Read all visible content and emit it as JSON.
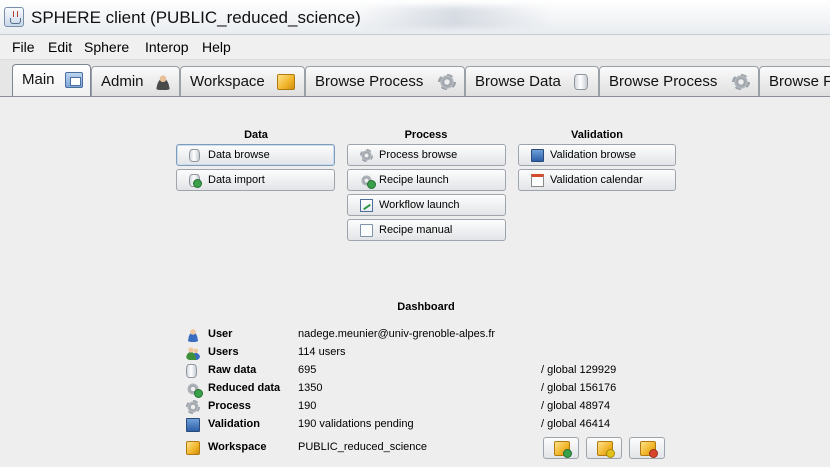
{
  "window": {
    "title": "SPHERE client (PUBLIC_reduced_science)"
  },
  "menu": [
    "File",
    "Edit",
    "Sphere",
    "Interop",
    "Help"
  ],
  "tabs": [
    {
      "label": "Main",
      "icon": "window-icon",
      "active": true
    },
    {
      "label": "Admin",
      "icon": "admin-user-icon"
    },
    {
      "label": "Workspace",
      "icon": "workspace-box-icon"
    },
    {
      "label": "Browse Process",
      "icon": "gear-icon"
    },
    {
      "label": "Browse Data",
      "icon": "database-icon"
    },
    {
      "label": "Browse Process",
      "icon": "gear-icon"
    },
    {
      "label": "Browse F",
      "icon": ""
    }
  ],
  "sections": {
    "data": {
      "title": "Data",
      "buttons": [
        {
          "label": "Data browse",
          "icon": "database-icon"
        },
        {
          "label": "Data import",
          "icon": "data-import-icon"
        }
      ]
    },
    "process": {
      "title": "Process",
      "buttons": [
        {
          "label": "Process browse",
          "icon": "gear-icon"
        },
        {
          "label": "Recipe launch",
          "icon": "recipe-launch-icon"
        },
        {
          "label": "Workflow launch",
          "icon": "workflow-icon"
        },
        {
          "label": "Recipe manual",
          "icon": "document-icon"
        }
      ]
    },
    "validation": {
      "title": "Validation",
      "buttons": [
        {
          "label": "Validation browse",
          "icon": "monitor-icon"
        },
        {
          "label": "Validation calendar",
          "icon": "calendar-icon"
        }
      ]
    }
  },
  "dashboard": {
    "title": "Dashboard",
    "rows": [
      {
        "label": "User",
        "value": "nadege.meunier@univ-grenoble-alpes.fr",
        "global": "",
        "icon": "user-icon"
      },
      {
        "label": "Users",
        "value": "114 users",
        "global": "",
        "icon": "users-icon"
      },
      {
        "label": "Raw data",
        "value": "695",
        "global": "/ global 129929",
        "icon": "database-icon"
      },
      {
        "label": "Reduced data",
        "value": "1350",
        "global": "/ global 156176",
        "icon": "reduced-data-icon"
      },
      {
        "label": "Process",
        "value": "190",
        "global": "/ global 48974",
        "icon": "gear-icon"
      },
      {
        "label": "Validation",
        "value": "190 validations pending",
        "global": "/ global 46414",
        "icon": "monitor-icon"
      },
      {
        "label": "Workspace",
        "value": "PUBLIC_reduced_science",
        "global": "",
        "icon": "workspace-box-icon"
      }
    ],
    "workspace_buttons": [
      "workspace-add-icon",
      "workspace-change-icon",
      "workspace-remove-icon"
    ]
  }
}
